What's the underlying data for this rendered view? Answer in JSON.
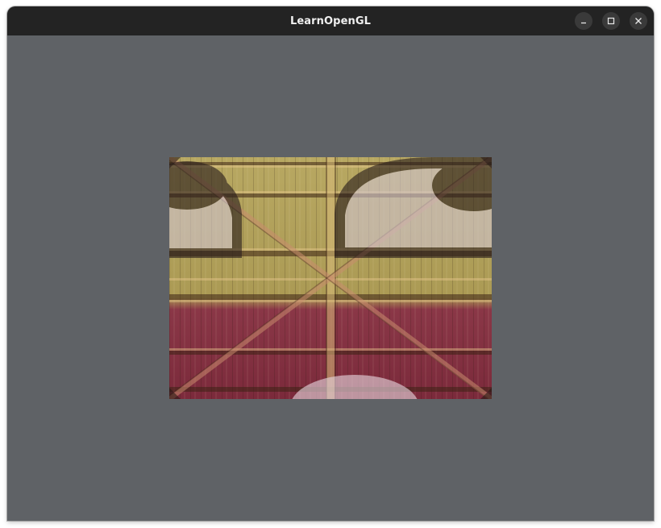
{
  "window": {
    "title": "LearnOpenGL",
    "controls": {
      "minimize": "minimize-icon",
      "maximize": "maximize-icon",
      "close": "close-icon"
    }
  },
  "render": {
    "clear_color": "#5f6266",
    "texture_top_tint": "#b5a457",
    "texture_bottom_tint": "#7a2a3c",
    "overlay_face_color": "#c8b8c2",
    "overlay_outline_color": "#2a1e1c"
  }
}
